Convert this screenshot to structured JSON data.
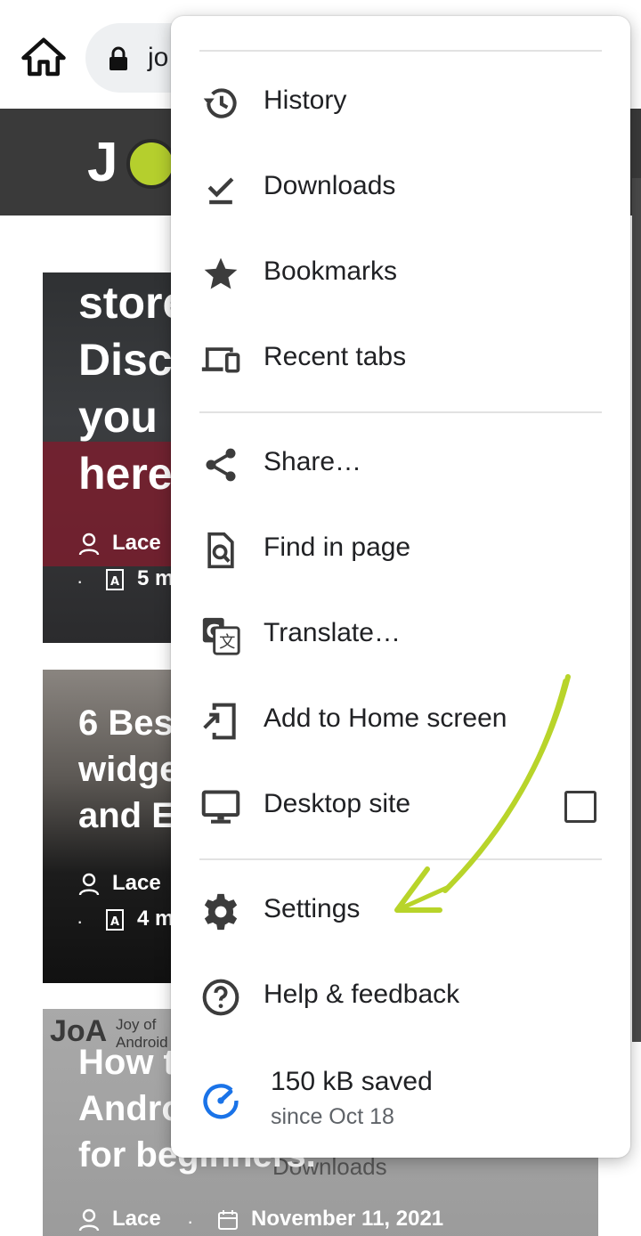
{
  "toolbar": {
    "url_fragment": "jo",
    "icons": [
      "home-icon",
      "lock-icon"
    ]
  },
  "site": {
    "logo_text": "J",
    "logo_mark_icon": "smiley-face-logo"
  },
  "articles": [
    {
      "title_lines": [
        "store",
        "Disc",
        "you",
        "here"
      ],
      "author": "Lace",
      "read_time": "5 m"
    },
    {
      "title_lines": [
        "6 Best",
        "widge",
        "and Ea"
      ],
      "author": "Lace",
      "read_time": "4 m"
    },
    {
      "logo_text": "JoA",
      "logo_sub": [
        "Joy of",
        "Android"
      ],
      "title_lines": [
        "How t",
        "Andro",
        "for beginners."
      ],
      "author": "Lace",
      "date": "November 11, 2021",
      "ghost_text": "Downloads"
    }
  ],
  "menu": {
    "items": [
      {
        "label": "History",
        "icon": "history-icon"
      },
      {
        "label": "Downloads",
        "icon": "download-icon"
      },
      {
        "label": "Bookmarks",
        "icon": "star-icon"
      },
      {
        "label": "Recent tabs",
        "icon": "devices-icon"
      },
      {
        "label": "Share…",
        "icon": "share-icon"
      },
      {
        "label": "Find in page",
        "icon": "find-in-page-icon"
      },
      {
        "label": "Translate…",
        "icon": "translate-icon"
      },
      {
        "label": "Add to Home screen",
        "icon": "add-to-home-screen-icon"
      },
      {
        "label": "Desktop site",
        "icon": "desktop-icon",
        "checked": false
      },
      {
        "label": "Settings",
        "icon": "gear-icon"
      },
      {
        "label": "Help & feedback",
        "icon": "help-icon"
      }
    ],
    "data_saver": {
      "title": "150 kB saved",
      "subtitle": "since Oct 18",
      "icon": "data-saver-gauge-icon"
    }
  },
  "colors": {
    "annotation_arrow": "#b8d42a",
    "data_saver_icon": "#1a73e8",
    "menu_icon": "#3c3c3c"
  }
}
